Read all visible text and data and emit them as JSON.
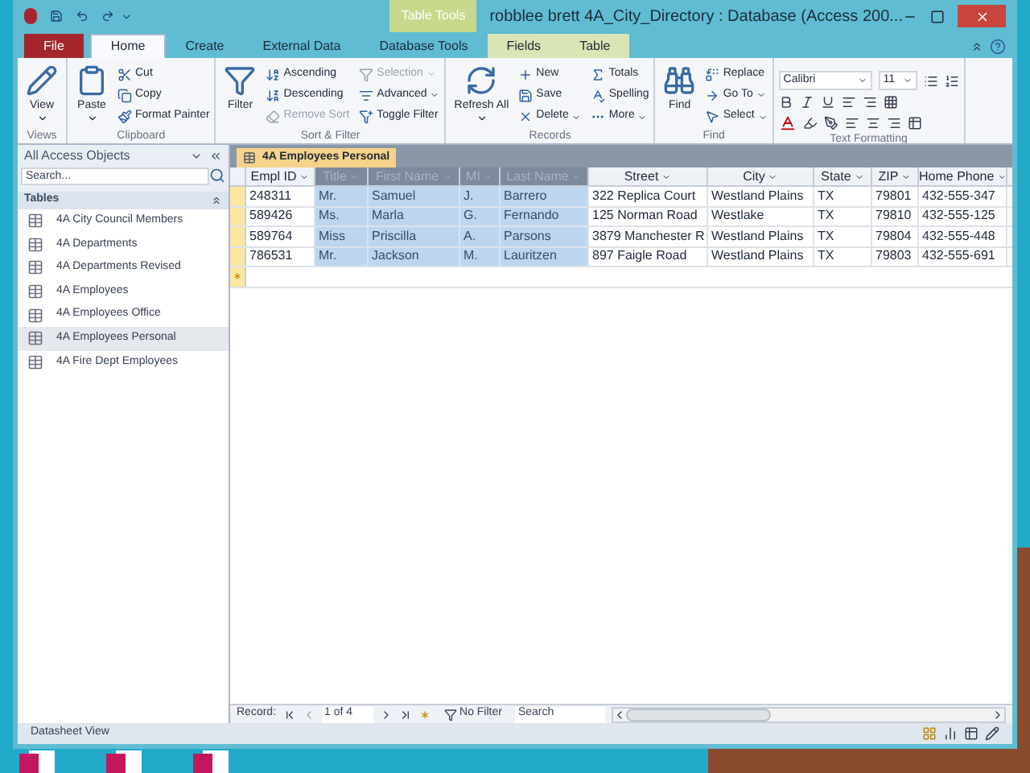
{
  "title_bar": {
    "context_label": "Table Tools",
    "title": "robblee brett 4A_City_Directory : Database (Access 200..."
  },
  "tabs": [
    {
      "label": "File",
      "kind": "file",
      "selected": false
    },
    {
      "label": "Home",
      "kind": "normal",
      "selected": true
    },
    {
      "label": "Create",
      "kind": "normal",
      "selected": false
    },
    {
      "label": "External Data",
      "kind": "normal",
      "selected": false
    },
    {
      "label": "Database Tools",
      "kind": "normal",
      "selected": false
    },
    {
      "label": "Fields",
      "kind": "context",
      "selected": false
    },
    {
      "label": "Table",
      "kind": "context",
      "selected": false
    }
  ],
  "ribbon": [
    {
      "label": "Views",
      "items": [
        {
          "label": "View",
          "kind": "large",
          "dropdown": true,
          "disabled": false
        }
      ]
    },
    {
      "label": "Clipboard",
      "items": [
        {
          "label": "Paste",
          "kind": "large",
          "dropdown": true,
          "disabled": false
        },
        {
          "label": "Cut",
          "kind": "small",
          "dropdown": false,
          "disabled": false
        },
        {
          "label": "Copy",
          "kind": "small",
          "dropdown": false,
          "disabled": false
        },
        {
          "label": "Format Painter",
          "kind": "small",
          "dropdown": false,
          "disabled": false
        }
      ]
    },
    {
      "label": "Sort & Filter",
      "items": [
        {
          "label": "Filter",
          "kind": "large",
          "dropdown": false,
          "disabled": false
        },
        {
          "label": "Ascending",
          "kind": "small",
          "dropdown": false,
          "disabled": false
        },
        {
          "label": "Descending",
          "kind": "small",
          "dropdown": false,
          "disabled": false
        },
        {
          "label": "Remove Sort",
          "kind": "small",
          "dropdown": false,
          "disabled": true
        },
        {
          "label": "Selection",
          "kind": "small",
          "dropdown": true,
          "disabled": true
        },
        {
          "label": "Advanced",
          "kind": "small",
          "dropdown": true,
          "disabled": false
        },
        {
          "label": "Toggle Filter",
          "kind": "small",
          "dropdown": false,
          "disabled": false
        }
      ]
    },
    {
      "label": "Records",
      "items": [
        {
          "label": "Refresh All",
          "kind": "large",
          "dropdown": true,
          "disabled": false
        },
        {
          "label": "New",
          "kind": "small",
          "dropdown": false,
          "disabled": false
        },
        {
          "label": "Save",
          "kind": "small",
          "dropdown": false,
          "disabled": false
        },
        {
          "label": "Delete",
          "kind": "small",
          "dropdown": true,
          "disabled": false
        },
        {
          "label": "Totals",
          "kind": "small",
          "dropdown": false,
          "disabled": false
        },
        {
          "label": "Spelling",
          "kind": "small",
          "dropdown": false,
          "disabled": false
        },
        {
          "label": "More",
          "kind": "small",
          "dropdown": true,
          "disabled": false
        }
      ]
    },
    {
      "label": "Find",
      "items": [
        {
          "label": "Find",
          "kind": "large",
          "dropdown": false,
          "disabled": false
        },
        {
          "label": "Replace",
          "kind": "small",
          "dropdown": false,
          "disabled": false
        },
        {
          "label": "Go To",
          "kind": "small",
          "dropdown": true,
          "disabled": false
        },
        {
          "label": "Select",
          "kind": "small",
          "dropdown": true,
          "disabled": false
        }
      ]
    },
    {
      "label": "Text Formatting",
      "items": [
        {
          "label": "Calibri",
          "kind": "font",
          "dropdown": true,
          "disabled": false
        },
        {
          "label": "11",
          "kind": "size",
          "dropdown": true,
          "disabled": false
        }
      ]
    }
  ],
  "nav_pane": {
    "title": "All Access Objects",
    "search_placeholder": "Search...",
    "section": "Tables",
    "items": [
      {
        "label": "4A City Council Members",
        "selected": false
      },
      {
        "label": "4A Departments",
        "selected": false
      },
      {
        "label": "4A Departments Revised",
        "selected": false
      },
      {
        "label": "4A Employees",
        "selected": false
      },
      {
        "label": "4A Employees Office",
        "selected": false
      },
      {
        "label": "4A Employees Personal",
        "selected": true
      },
      {
        "label": "4A Fire Dept Employees",
        "selected": false
      }
    ]
  },
  "datasheet": {
    "tab": "4A Employees Personal",
    "columns": [
      {
        "label": "Empl ID",
        "selected": false
      },
      {
        "label": "Title",
        "selected": true
      },
      {
        "label": "First Name",
        "selected": true
      },
      {
        "label": "MI",
        "selected": true
      },
      {
        "label": "Last Name",
        "selected": true
      },
      {
        "label": "Street",
        "selected": false
      },
      {
        "label": "City",
        "selected": false
      },
      {
        "label": "State",
        "selected": false
      },
      {
        "label": "ZIP",
        "selected": false
      },
      {
        "label": "Home Phone",
        "selected": false
      }
    ],
    "rows": [
      [
        "248311",
        "Mr.",
        "Samuel",
        "J.",
        "Barrero",
        "322 Replica Court",
        "Westland Plains",
        "TX",
        "79801",
        "432-555-347"
      ],
      [
        "589426",
        "Ms.",
        "Marla",
        "G.",
        "Fernando",
        "125 Norman Road",
        "Westlake",
        "TX",
        "79810",
        "432-555-125"
      ],
      [
        "589764",
        "Miss",
        "Priscilla",
        "A.",
        "Parsons",
        "3879 Manchester R",
        "Westland Plains",
        "TX",
        "79804",
        "432-555-448"
      ],
      [
        "786531",
        "Mr.",
        "Jackson",
        "M.",
        "Lauritzen",
        "897 Faigle Road",
        "Westland Plains",
        "TX",
        "79803",
        "432-555-691"
      ]
    ],
    "record_nav": {
      "label": "Record:",
      "position": "1 of 4",
      "filter": "No Filter",
      "search": "Search"
    }
  },
  "status_bar": {
    "text": "Datasheet View"
  }
}
